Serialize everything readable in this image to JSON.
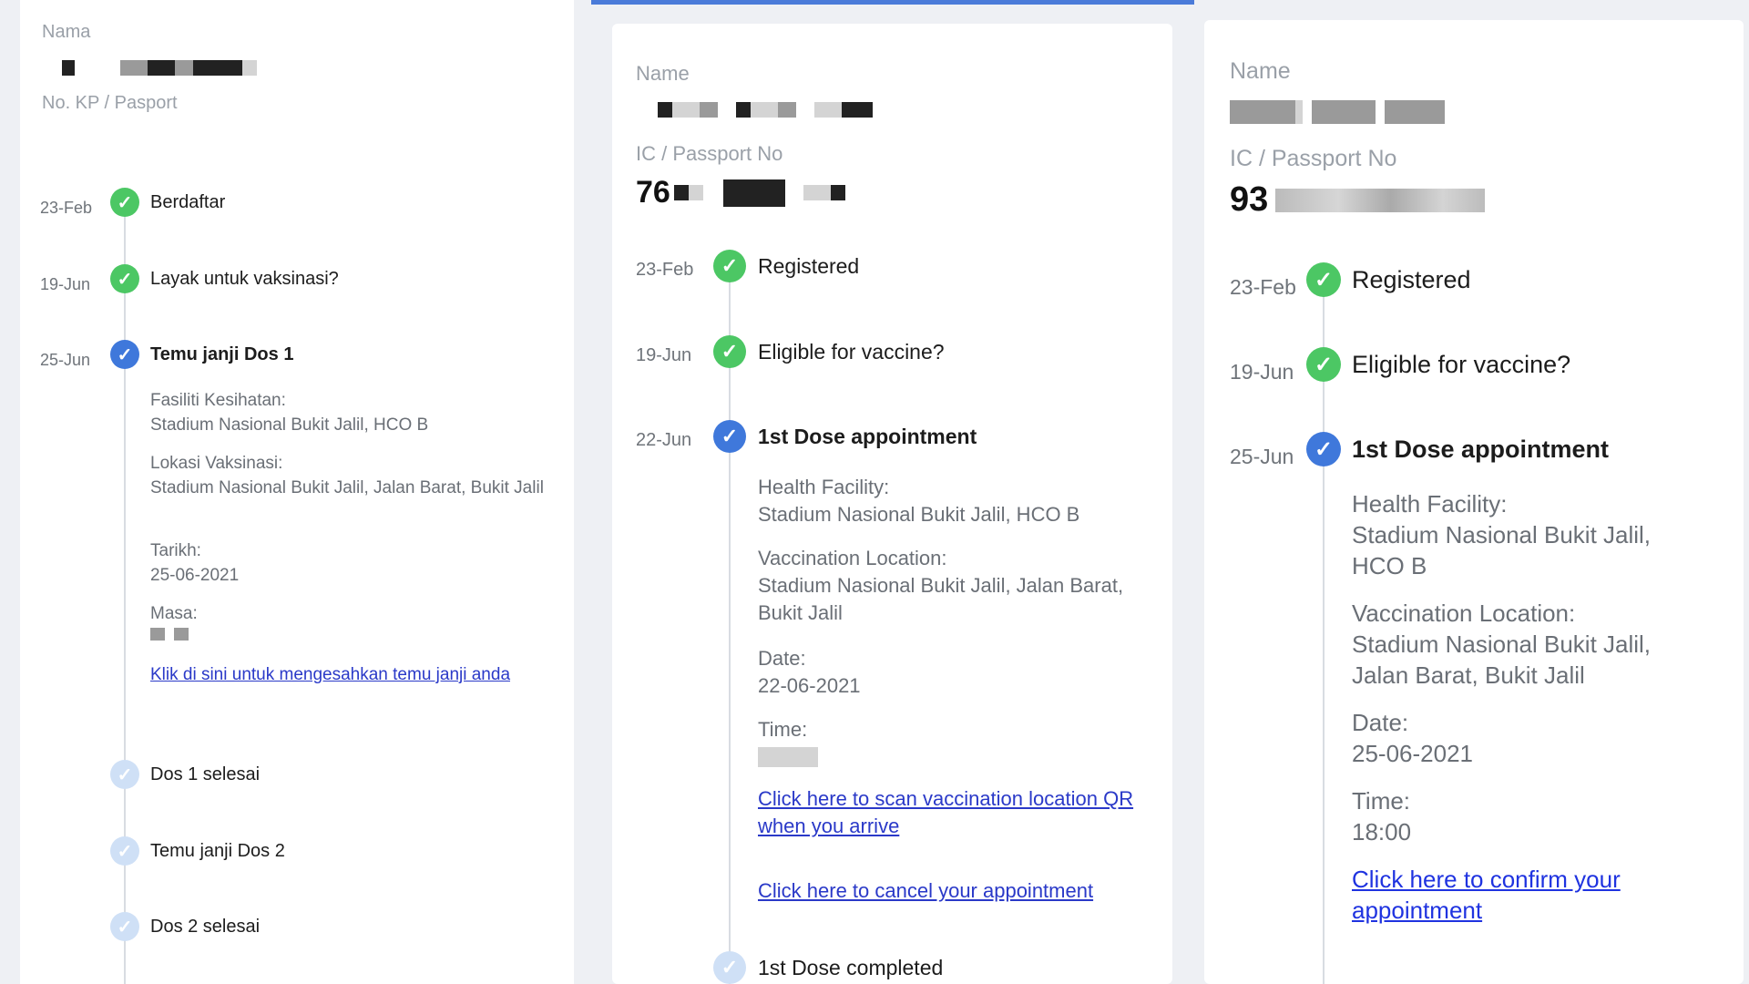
{
  "malay": {
    "name_label": "Nama",
    "id_label": "No. KP / Pasport",
    "timeline": [
      {
        "date": "23-Feb",
        "title": "Berdaftar",
        "status": "done"
      },
      {
        "date": "19-Jun",
        "title": "Layak untuk vaksinasi?",
        "status": "done"
      },
      {
        "date": "25-Jun",
        "title": "Temu janji Dos 1",
        "status": "current"
      },
      {
        "date": "",
        "title": "Dos 1 selesai",
        "status": "pending"
      },
      {
        "date": "",
        "title": "Temu janji Dos 2",
        "status": "pending"
      },
      {
        "date": "",
        "title": "Dos 2 selesai",
        "status": "pending"
      }
    ],
    "details": [
      {
        "label": "Fasiliti Kesihatan:",
        "value": "Stadium Nasional Bukit Jalil, HCO B"
      },
      {
        "label": "Lokasi Vaksinasi:",
        "value": "Stadium Nasional Bukit Jalil, Jalan Barat, Bukit Jalil"
      },
      {
        "label": "Tarikh:",
        "value": "25-06-2021"
      },
      {
        "label": "Masa:",
        "value": ""
      }
    ],
    "link": "Klik di sini untuk mengesahkan temu janji anda"
  },
  "english_a": {
    "name_label": "Name",
    "id_label": "IC / Passport No",
    "id_prefix": "76",
    "timeline": [
      {
        "date": "23-Feb",
        "title": "Registered",
        "status": "done"
      },
      {
        "date": "19-Jun",
        "title": "Eligible for vaccine?",
        "status": "done"
      },
      {
        "date": "22-Jun",
        "title": "1st Dose appointment",
        "status": "current"
      },
      {
        "date": "",
        "title": "1st Dose completed",
        "status": "pending"
      }
    ],
    "details": [
      {
        "label": "Health Facility:",
        "value": "Stadium Nasional Bukit Jalil, HCO B"
      },
      {
        "label": "Vaccination Location:",
        "value": "Stadium Nasional Bukit Jalil, Jalan Barat, Bukit Jalil"
      },
      {
        "label": "Date:",
        "value": "22-06-2021"
      },
      {
        "label": "Time:",
        "value": ""
      }
    ],
    "links": [
      "Click here to scan vaccination location QR when you arrive",
      "Click here to cancel your appointment"
    ]
  },
  "english_b": {
    "name_label": "Name",
    "id_label": "IC / Passport No",
    "id_prefix": "93",
    "timeline": [
      {
        "date": "23-Feb",
        "title": "Registered",
        "status": "done"
      },
      {
        "date": "19-Jun",
        "title": "Eligible for vaccine?",
        "status": "done"
      },
      {
        "date": "25-Jun",
        "title": "1st Dose appointment",
        "status": "current"
      }
    ],
    "details": [
      {
        "label": "Health Facility:",
        "value": "Stadium Nasional Bukit Jalil, HCO B"
      },
      {
        "label": "Vaccination Location:",
        "value": "Stadium Nasional Bukit Jalil, Jalan Barat, Bukit Jalil"
      },
      {
        "label": "Date:",
        "value": "25-06-2021"
      },
      {
        "label": "Time:",
        "value": "18:00"
      }
    ],
    "link": "Click here to confirm your appointment"
  },
  "icons": {
    "done": "check-circle-green-icon",
    "current": "check-circle-blue-icon",
    "pending": "check-circle-pale-icon"
  },
  "colors": {
    "done": "#4cc764",
    "current": "#3f78db",
    "pending": "#cfe0f6",
    "link": "#2a39c8",
    "accent_bar": "#4a7bd9"
  }
}
